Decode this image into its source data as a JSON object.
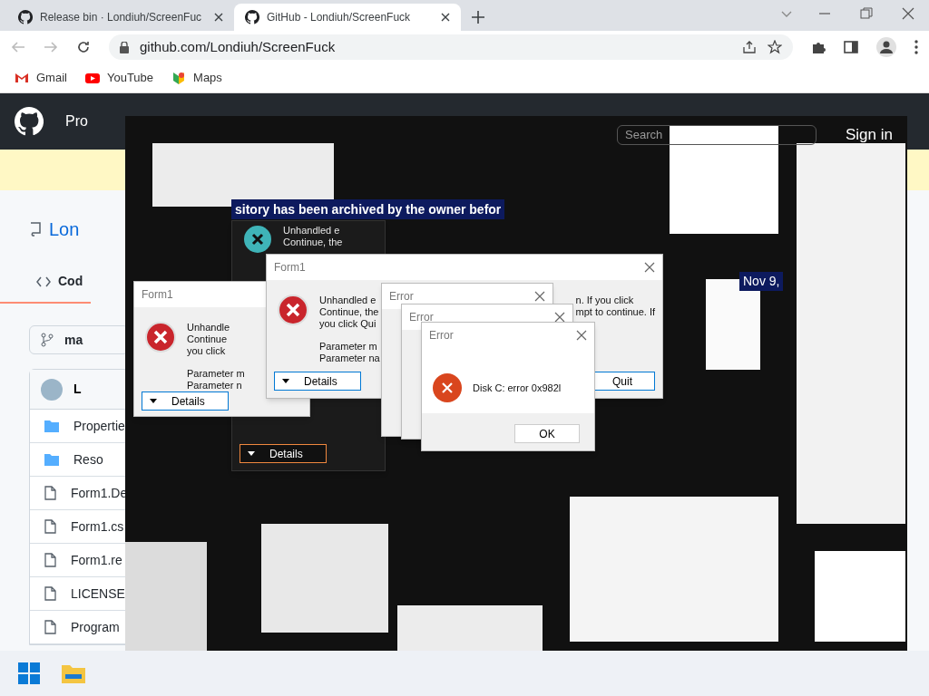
{
  "browser": {
    "tabs": [
      {
        "title": "Release bin · Londiuh/ScreenFuc",
        "selected": false
      },
      {
        "title": "GitHub - Londiuh/ScreenFuck",
        "selected": true
      }
    ],
    "address": "github.com/Londiuh/ScreenFuck",
    "bookmarks": [
      {
        "label": "Gmail",
        "kind": "gmail"
      },
      {
        "label": "YouTube",
        "kind": "youtube"
      },
      {
        "label": "Maps",
        "kind": "maps"
      }
    ]
  },
  "page": {
    "nav_text": "Pro",
    "search": "Search",
    "sign_in": "Sign in",
    "repo_name": "Lon",
    "code_tab": "Cod",
    "branch": "ma",
    "owner": "L",
    "files": [
      {
        "name": "Propertie",
        "kind": "folder"
      },
      {
        "name": "Reso",
        "kind": "folder"
      },
      {
        "name": "Form1.De",
        "kind": "file"
      },
      {
        "name": "Form1.cs",
        "kind": "file"
      },
      {
        "name": "Form1.re",
        "kind": "file"
      },
      {
        "name": "LICENSE",
        "kind": "file"
      },
      {
        "name": "Program",
        "kind": "file"
      }
    ]
  },
  "banner": "sitory has been archived by the owner befor",
  "date": "Nov 9,",
  "windows": [
    {
      "kind": "dark",
      "lines": [
        "Unhandled e",
        "Continue, the"
      ],
      "buttons": [
        {
          "label": "Details",
          "kind": "details"
        }
      ]
    },
    {
      "kind": "form",
      "title": "Form1",
      "lines": [
        "Unhandle",
        "Continue",
        "you click"
      ],
      "params": [
        "Parameter m",
        "Parameter n"
      ],
      "buttons": [
        {
          "label": "Details",
          "kind": "details"
        }
      ]
    },
    {
      "kind": "form",
      "title": "Form1",
      "lines": [
        "Unhandled e",
        "Continue, the",
        "you click Qui"
      ],
      "params": [
        "Parameter m",
        "Parameter na"
      ],
      "side_lines": [
        "n. If you click",
        "mpt to continue. If"
      ],
      "buttons": [
        {
          "label": "Details",
          "kind": "details"
        },
        {
          "label": "Quit",
          "kind": "plain"
        }
      ]
    },
    {
      "kind": "stub",
      "title": "Error"
    },
    {
      "kind": "stub",
      "title": "Error"
    },
    {
      "kind": "error",
      "title": "Error",
      "lines": [
        "Disk C: error 0x982l"
      ],
      "buttons": [
        {
          "label": "OK",
          "kind": "plain"
        }
      ]
    }
  ]
}
